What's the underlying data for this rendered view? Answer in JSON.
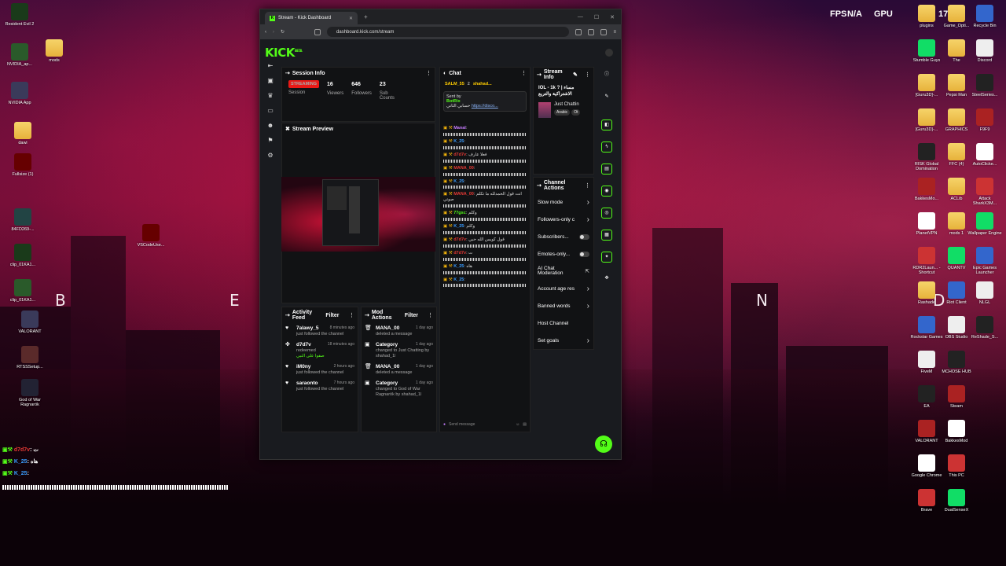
{
  "desktop": {
    "overlay_labels": {
      "fps": "FPS",
      "fps_value": "N/A",
      "gpu": "GPU",
      "cpu_value": "17"
    },
    "wallpaper_letters": [
      "B",
      "E",
      "N",
      "D"
    ],
    "left_icons": [
      "Resident Evil 2",
      "NVIDIA_ap...",
      "NVIDIA App",
      "mods",
      "dawi",
      "Fullsize (1)",
      "84FD269-...",
      "clip_01KA1...",
      "clip_01KA1...",
      "VALORANT",
      "RTSSSetup...",
      "God of War Ragnarök",
      "VSCodeUse..."
    ],
    "right_icons": [
      "plugins",
      "Stumble Guys",
      "[Guru3D]-...",
      "[Guru3D]-...",
      "RISK Global Domination",
      "BakkesMo...",
      "PlanetVPN",
      "RDR2Laun... - Shortcut",
      "Rashade",
      "Rockstar Games",
      "FiveM",
      "EA",
      "VALORANT",
      "Google Chrome",
      "Brave",
      "Game_Opti...",
      "The",
      "Pepsi Man",
      "GRAPHICS",
      "FFC (4)",
      "ACLib",
      "mods 1",
      "QUANTV",
      "Riot Client",
      "OBS Studio",
      "MCHOSE HUB",
      "Steam",
      "BakkesMod",
      "This PC",
      "DualSenseX",
      "Recycle Bin",
      "Discord",
      "SteelSeries...",
      "F9F9",
      "AutoClicke...",
      "Attack SharkX3M...",
      "Wallpaper Engine",
      "Epic Games Launcher",
      "NLGL",
      "ReShade_S..."
    ]
  },
  "browser": {
    "tab_title": "Stream - Kick Dashboard",
    "url": "dashboard.kick.com/stream"
  },
  "kick": {
    "logo": "KICK",
    "beta": "BETA"
  },
  "session": {
    "title": "Session Info",
    "status": "STREAMING",
    "stats": [
      {
        "value": "16",
        "label": "Viewers"
      },
      {
        "value": "646",
        "label": "Followers"
      },
      {
        "value": "23",
        "label": "Sub Counts"
      }
    ],
    "session_label": "Session"
  },
  "preview": {
    "title": "Stream Preview"
  },
  "activity": {
    "title": "Activity Feed",
    "filter": "Filter",
    "items": [
      {
        "user": "7alawy_5",
        "action": "just followed the channel",
        "time": "8 minutes ago"
      },
      {
        "user": "d7d7v",
        "action": "redeemed",
        "extra": "صفوا على النبي",
        "time": "18 minutes ago"
      },
      {
        "user": "iM0ny",
        "action": "just followed the channel",
        "time": "2 hours ago"
      },
      {
        "user": "saraonto",
        "action": "just followed the channel",
        "time": "7 hours ago"
      }
    ]
  },
  "mod": {
    "title": "Mod Actions",
    "filter": "Filter",
    "items": [
      {
        "user": "MANA_00",
        "action": "deleted a message",
        "time": "1 day ago"
      },
      {
        "user": "Category",
        "action": "changed to Just Chatting by shahad_1l",
        "time": "1 day ago"
      },
      {
        "user": "MANA_00",
        "action": "deleted a message",
        "time": "1 day ago"
      },
      {
        "user": "Category",
        "action": "changed to God of War Ragnarök by shahad_1l",
        "time": "1 day ago"
      }
    ]
  },
  "chat": {
    "title": "Chat",
    "pinned_users": [
      "SALM_55",
      "2",
      "shahad..."
    ],
    "pinned": {
      "sent_by": "Sent by",
      "user": "BotRix",
      "text": "حسابي الثاني",
      "link": "https://disco..."
    },
    "messages": [
      {
        "user": "Manal",
        "color": "#c77dff",
        "text": ""
      },
      {
        "user": "K_25",
        "color": "#3a9dff",
        "text": ""
      },
      {
        "user": "d7d7v",
        "color": "#e53935",
        "text": "فعلا عارف"
      },
      {
        "user": "MANA_00",
        "color": "#e53935",
        "text": ""
      },
      {
        "user": "K_25",
        "color": "#3a9dff",
        "text": ""
      },
      {
        "user": "MANA_00",
        "color": "#e53935",
        "text": "انت قول الحمدلله ما تكلم صوتي"
      },
      {
        "user": "77gsc",
        "color": "#53fc18",
        "text": "وكلم"
      },
      {
        "user": "K_25",
        "color": "#3a9dff",
        "text": "وكلم"
      },
      {
        "user": "d7d7v",
        "color": "#e53935",
        "text": "قول كويس الله حبي"
      },
      {
        "user": "d7d7v",
        "color": "#e53935",
        "text": "ت"
      },
      {
        "user": "K_25",
        "color": "#3a9dff",
        "text": "هاه"
      },
      {
        "user": "K_25",
        "color": "#3a9dff",
        "text": ""
      }
    ],
    "input_placeholder": "Send message"
  },
  "stream_info": {
    "title": "Stream Info",
    "stream_title": "IOL - 1k ? | مساء الاشتراكية والتريع",
    "category": "Just Chattin",
    "tags": [
      "Arabic",
      "Ot"
    ]
  },
  "channel_actions": {
    "title": "Channel Actions",
    "items": [
      {
        "label": "Slow mode",
        "kind": "arrow"
      },
      {
        "label": "Followers-only c",
        "kind": "arrow"
      },
      {
        "label": "Subscribers...",
        "kind": "toggle"
      },
      {
        "label": "Emotes-only...",
        "kind": "toggle"
      },
      {
        "label": "AI Chat Moderation",
        "kind": "link"
      },
      {
        "label": "Account age res",
        "kind": "arrow"
      },
      {
        "label": "Banned words",
        "kind": "arrow"
      },
      {
        "label": "Host Channel",
        "kind": "none"
      },
      {
        "label": "Set goals",
        "kind": "arrow"
      }
    ]
  },
  "overlay_chat": [
    {
      "user": "d7d7v",
      "color": "#e53935",
      "text": ": ت"
    },
    {
      "user": "K_25",
      "color": "#3a9dff",
      "text": ": هاه"
    },
    {
      "user": "K_25",
      "color": "#3a9dff",
      "text": ":"
    }
  ],
  "colors": {
    "kick_green": "#53fc18",
    "live_red": "#e91916",
    "panel": "#111214"
  }
}
